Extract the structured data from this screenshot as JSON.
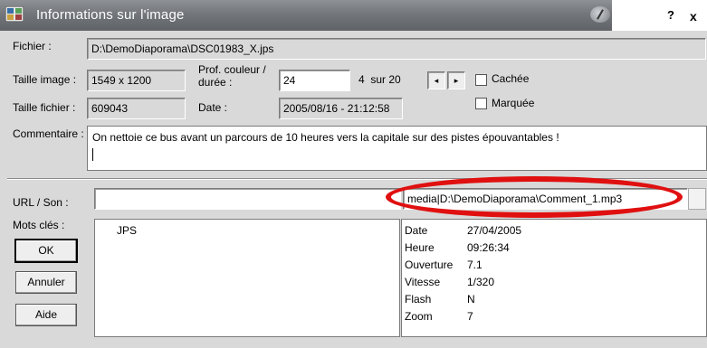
{
  "window": {
    "title": "Informations sur l'image",
    "help": "?",
    "close": "x"
  },
  "labels": {
    "fichier": "Fichier :",
    "taille_image": "Taille image :",
    "taille_fichier": "Taille fichier :",
    "prof_couleur": "Prof. couleur /",
    "duree": "durée :",
    "date": "Date :",
    "commentaire": "Commentaire :",
    "url_son": "URL / Son :",
    "mots_cles": "Mots clés :"
  },
  "fields": {
    "fichier": "D:\\DemoDiaporama\\DSC01983_X.jps",
    "taille_image": "1549 x 1200",
    "taille_fichier": "609043",
    "prof_couleur": "24",
    "date": "2005/08/16 - 21:12:58",
    "counter": "4  sur 20",
    "commentaire": "On nettoie ce bus avant un parcours de 10 heures vers la capitale sur des pistes épouvantables !",
    "url": "",
    "media": "media|D:\\DemoDiaporama\\Comment_1.mp3"
  },
  "checkboxes": {
    "cachee": "Cachée",
    "marquee": "Marquée"
  },
  "nav": {
    "prev": "◂",
    "next": "▸"
  },
  "buttons": {
    "ok": "OK",
    "annuler": "Annuler",
    "aide": "Aide"
  },
  "keywords": [
    "JPS"
  ],
  "exif": [
    {
      "key": "Date",
      "value": "27/04/2005"
    },
    {
      "key": "Heure",
      "value": "09:26:34"
    },
    {
      "key": "Ouverture",
      "value": "7.1"
    },
    {
      "key": "Vitesse",
      "value": "1/320"
    },
    {
      "key": "Flash",
      "value": "N"
    },
    {
      "key": "Zoom",
      "value": "7"
    }
  ],
  "colors": {
    "title_bar": "#73767b",
    "highlight_ellipse": "#e01010",
    "dialog_bg": "#d9d9d9"
  }
}
